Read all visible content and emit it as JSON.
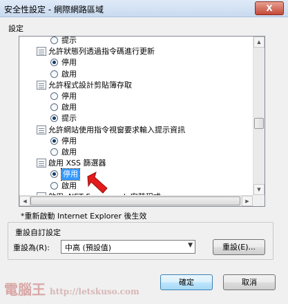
{
  "window": {
    "title": "安全性設定 - 網際網路區域",
    "close_glyph": "X"
  },
  "group_label": "設定",
  "tree": {
    "rows": [
      {
        "kind": "option",
        "label": "提示",
        "checked": false
      },
      {
        "kind": "folder",
        "label": "允許狀態列透過指令碼進行更新"
      },
      {
        "kind": "option",
        "label": "停用",
        "checked": true
      },
      {
        "kind": "option",
        "label": "啟用",
        "checked": false
      },
      {
        "kind": "folder",
        "label": "允許程式設計剪貼簿存取"
      },
      {
        "kind": "option",
        "label": "停用",
        "checked": false
      },
      {
        "kind": "option",
        "label": "啟用",
        "checked": false
      },
      {
        "kind": "option",
        "label": "提示",
        "checked": true
      },
      {
        "kind": "folder",
        "label": "允許網站使用指令視窗要求輸入提示資訊"
      },
      {
        "kind": "option",
        "label": "停用",
        "checked": true
      },
      {
        "kind": "option",
        "label": "啟用",
        "checked": false
      },
      {
        "kind": "folder",
        "label": "啟用 XSS 篩選器"
      },
      {
        "kind": "option",
        "label": "停用",
        "checked": true,
        "selected": true
      },
      {
        "kind": "option",
        "label": "啟用",
        "checked": false
      },
      {
        "kind": "folder",
        "label": "啟用 .NET Framework 安裝程式"
      }
    ]
  },
  "note": "*重新啟動 Internet Explorer 後生效",
  "reset_section": {
    "legend": "重設自訂設定",
    "label": "重設為(R):",
    "combo_value": "中高 (預設值)",
    "reset_button": "重設(E)..."
  },
  "buttons": {
    "ok": "確定",
    "cancel": "取消"
  },
  "watermark": {
    "brand": "電腦王",
    "url": "http://letskuso.com"
  },
  "colors": {
    "selection": "#3399ff",
    "arrow": "#e21b1b",
    "titlebar": "#c9daf0"
  }
}
